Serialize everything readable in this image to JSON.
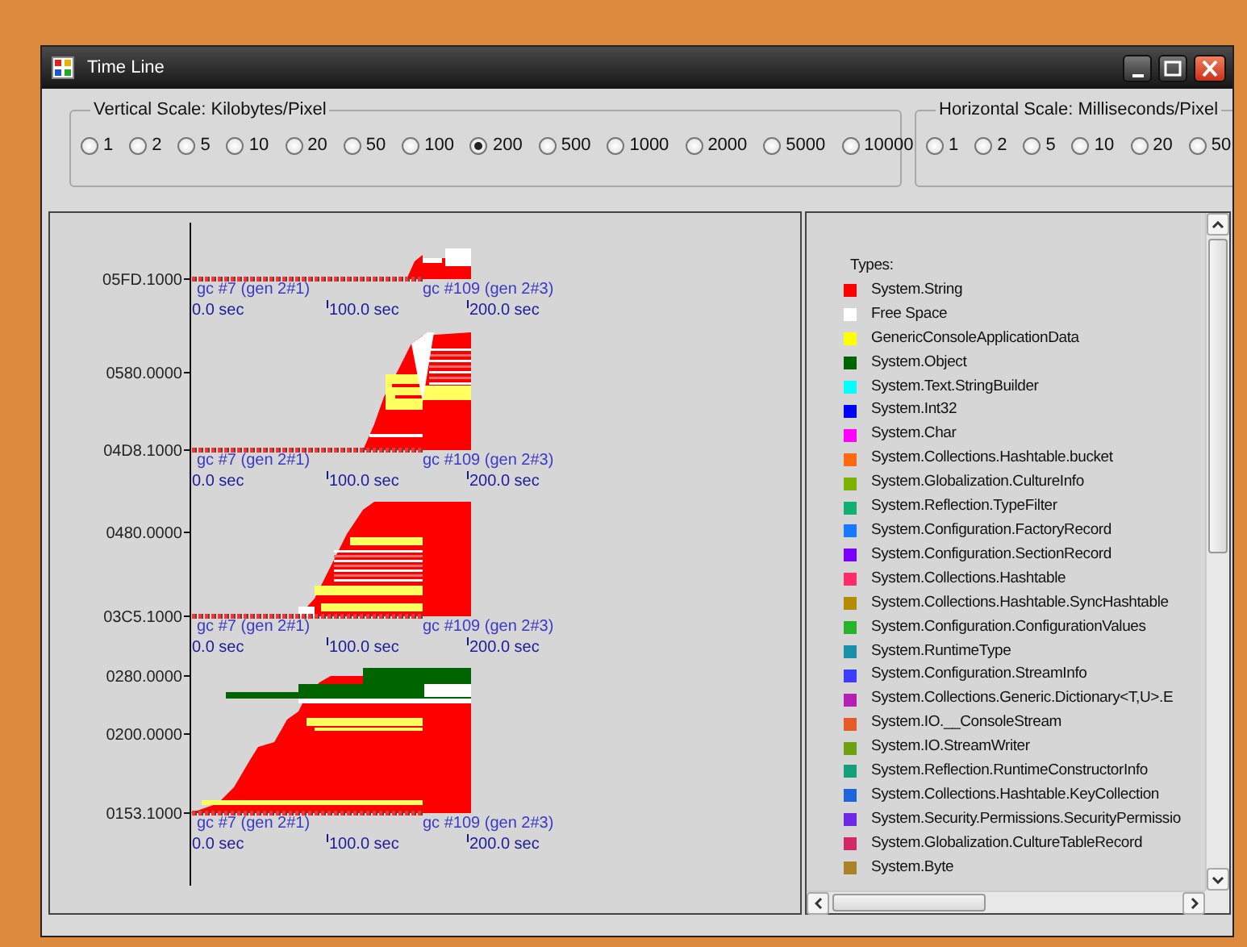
{
  "window": {
    "title": "Time Line"
  },
  "vertical_scale": {
    "label": "Vertical Scale: Kilobytes/Pixel",
    "options": [
      {
        "label": "1",
        "selected": false
      },
      {
        "label": "2",
        "selected": false
      },
      {
        "label": "5",
        "selected": false
      },
      {
        "label": "10",
        "selected": false
      },
      {
        "label": "20",
        "selected": false
      },
      {
        "label": "50",
        "selected": false
      },
      {
        "label": "100",
        "selected": false
      },
      {
        "label": "200",
        "selected": true
      },
      {
        "label": "500",
        "selected": false
      },
      {
        "label": "1000",
        "selected": false
      },
      {
        "label": "2000",
        "selected": false
      },
      {
        "label": "5000",
        "selected": false
      },
      {
        "label": "10000",
        "selected": false
      }
    ]
  },
  "horizontal_scale": {
    "label": "Horizontal Scale: Milliseconds/Pixel",
    "options": [
      {
        "label": "1",
        "selected": false
      },
      {
        "label": "2",
        "selected": false
      },
      {
        "label": "5",
        "selected": false
      },
      {
        "label": "10",
        "selected": false
      },
      {
        "label": "20",
        "selected": false
      },
      {
        "label": "50",
        "selected": false
      }
    ]
  },
  "timeline": {
    "panels": [
      {
        "y_ticks": [
          "05FD.1000"
        ],
        "x_ticks": [
          "0.0 sec",
          "100.0 sec",
          "200.0 sec"
        ],
        "gc_markers": [
          "gc #7 (gen 2#1)",
          "gc #109 (gen 2#3)"
        ]
      },
      {
        "y_ticks": [
          "0580.0000",
          "04D8.1000"
        ],
        "x_ticks": [
          "0.0 sec",
          "100.0 sec",
          "200.0 sec"
        ],
        "gc_markers": [
          "gc #7 (gen 2#1)",
          "gc #109 (gen 2#3)"
        ]
      },
      {
        "y_ticks": [
          "0480.0000",
          "03C5.1000"
        ],
        "x_ticks": [
          "0.0 sec",
          "100.0 sec",
          "200.0 sec"
        ],
        "gc_markers": [
          "gc #7 (gen 2#1)",
          "gc #109 (gen 2#3)"
        ]
      },
      {
        "y_ticks": [
          "0280.0000",
          "0200.0000",
          "0153.1000"
        ],
        "x_ticks": [
          "0.0 sec",
          "100.0 sec",
          "200.0 sec"
        ],
        "gc_markers": [
          "gc #7 (gen 2#1)",
          "gc #109 (gen 2#3)"
        ]
      }
    ]
  },
  "legend": {
    "title": "Types:",
    "items": [
      {
        "label": "System.String",
        "color": "#ff0000"
      },
      {
        "label": "Free Space",
        "color": "#ffffff"
      },
      {
        "label": "GenericConsoleApplicationData",
        "color": "#ffff00"
      },
      {
        "label": "System.Object",
        "color": "#006400"
      },
      {
        "label": "System.Text.StringBuilder",
        "color": "#00ffff"
      },
      {
        "label": "System.Int32",
        "color": "#0000ff"
      },
      {
        "label": "System.Char",
        "color": "#ff00ff"
      },
      {
        "label": "System.Collections.Hashtable.bucket",
        "color": "#ff6a10"
      },
      {
        "label": "System.Globalization.CultureInfo",
        "color": "#7ab400"
      },
      {
        "label": "System.Reflection.TypeFilter",
        "color": "#10b070"
      },
      {
        "label": "System.Configuration.FactoryRecord",
        "color": "#1a78ff"
      },
      {
        "label": "System.Configuration.SectionRecord",
        "color": "#7800ff"
      },
      {
        "label": "System.Collections.Hashtable",
        "color": "#ff2c6c"
      },
      {
        "label": "System.Collections.Hashtable.SyncHashtable",
        "color": "#b48c00"
      },
      {
        "label": "System.Configuration.ConfigurationValues",
        "color": "#28b428"
      },
      {
        "label": "System.RuntimeType",
        "color": "#1890a8"
      },
      {
        "label": "System.Configuration.StreamInfo",
        "color": "#3c3cff"
      },
      {
        "label": "System.Collections.Generic.Dictionary<T,U>.E",
        "color": "#b420b4"
      },
      {
        "label": "System.IO.__ConsoleStream",
        "color": "#e65a28"
      },
      {
        "label": "System.IO.StreamWriter",
        "color": "#6ea014"
      },
      {
        "label": "System.Reflection.RuntimeConstructorInfo",
        "color": "#14a078"
      },
      {
        "label": "System.Collections.Hashtable.KeyCollection",
        "color": "#1e64dc"
      },
      {
        "label": "System.Security.Permissions.SecurityPermissio",
        "color": "#6e28e6"
      },
      {
        "label": "System.Globalization.CultureTableRecord",
        "color": "#d22864"
      },
      {
        "label": "System.Byte",
        "color": "#aa8228"
      }
    ]
  }
}
